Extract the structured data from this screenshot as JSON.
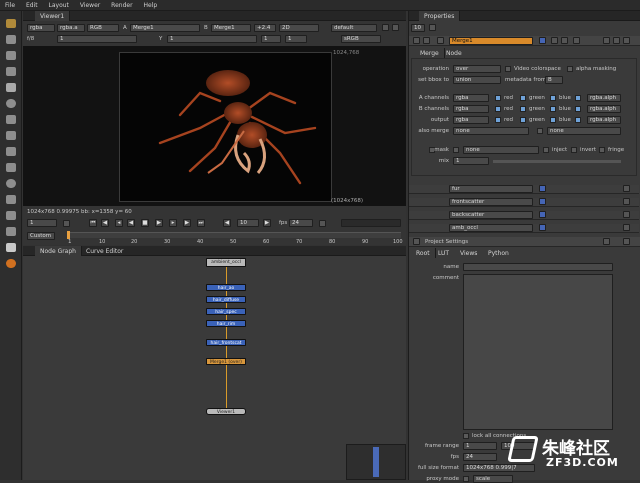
{
  "menu": [
    "File",
    "Edit",
    "Layout",
    "Viewer",
    "Render",
    "Help"
  ],
  "viewer": {
    "tab": "Viewer1",
    "row1": {
      "channels": "rgba",
      "layer": "rgba.a",
      "space": "RGB",
      "a_label": "A",
      "a_input": "Merge1",
      "b_label": "B",
      "b_input": "Merge1",
      "zoom": "+2.4",
      "view": "2D",
      "lut": "default"
    },
    "row2": {
      "frac": "f/8",
      "frac_val": "1",
      "y_label": "Y",
      "y_val": "1",
      "frame": "1",
      "gamma_label": "1",
      "lut2": "sRGB"
    },
    "format_label_tr": "1024,768",
    "format_label_br": "(1024x768)",
    "status": "1024x768 0.99975 bb: x=1358 y= 60",
    "frame_field": "1",
    "fps_label": "fps",
    "fps_val": "24",
    "range_mode": "Custom",
    "timeline_ticks": [
      "10",
      "20",
      "30",
      "40",
      "50",
      "60",
      "70",
      "80",
      "90",
      "100"
    ],
    "timeline_start": "1",
    "playback_step": "10"
  },
  "nodegraph": {
    "tabs": [
      "Node Graph",
      "Curve Editor"
    ],
    "nodes": [
      {
        "label": "ambient_occl",
        "kind": "gray"
      },
      {
        "label": "hair_ao",
        "kind": "blue"
      },
      {
        "label": "hair_diffuse",
        "kind": "blue"
      },
      {
        "label": "hair_spec",
        "kind": "blue"
      },
      {
        "label": "hair_rim",
        "kind": "blue"
      },
      {
        "label": "hair_frontscat",
        "kind": "blue"
      },
      {
        "label": "Merge1 (over)",
        "kind": "orange"
      },
      {
        "label": "Viewer1",
        "kind": "gray"
      }
    ]
  },
  "properties": {
    "tab": "Properties",
    "count": "10",
    "merge_node": {
      "name": "Merge1",
      "tabs": [
        "Merge",
        "Node"
      ],
      "operation_label": "operation",
      "operation": "over",
      "video_colorspace": "Video colorspace",
      "alpha_masking": "alpha masking",
      "bbox_label": "set bbox to",
      "bbox": "union",
      "metadata_label": "metadata from",
      "metadata": "B",
      "a_channels_label": "A channels",
      "a_channels": "rgba",
      "b_channels_label": "B channels",
      "b_channels": "rgba",
      "output_label": "output",
      "output": "rgba",
      "red": "red",
      "green": "green",
      "blue": "blue",
      "alpha_ch": "rgba.alph",
      "also_merge_label": "also merge",
      "also_merge": "none",
      "also_merge2": "none",
      "mask_label": "mask",
      "mask": "none",
      "inject": "inject",
      "invert": "invert",
      "fringe": "fringe",
      "mix_label": "mix",
      "mix": "1"
    },
    "collapsed_nodes": [
      "fur",
      "frontscatter",
      "backscatter",
      "amb_occl"
    ],
    "project": {
      "title": "Project Settings",
      "tabs": [
        "Root",
        "LUT",
        "Views",
        "Python"
      ],
      "name_label": "name",
      "comment_label": "comment",
      "lock_label": "lock all connections",
      "frame_range_label": "frame range",
      "frame_start": "1",
      "frame_end": "100",
      "fps_label": "fps",
      "fps": "24",
      "full_size_label": "full size format",
      "full_size": "1024x768 0.999|7",
      "proxy_mode_label": "proxy mode",
      "proxy_mode": "scale"
    }
  },
  "watermark": {
    "text": "朱峰社区",
    "url": "ZF3D.COM"
  }
}
